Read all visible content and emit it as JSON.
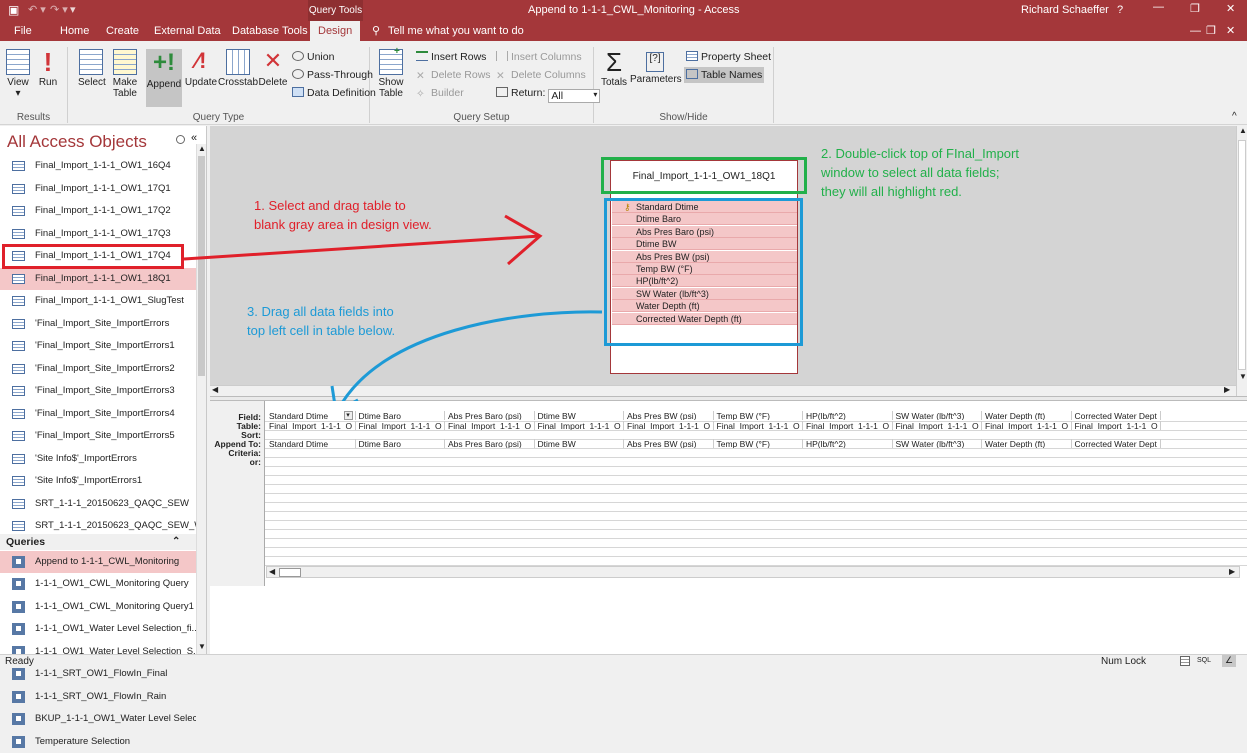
{
  "window": {
    "title": "Append to 1-1-1_CWL_Monitoring - Access",
    "context_tab": "Query Tools",
    "user": "Richard Schaeffer",
    "help": "?",
    "accent": "#a4373a"
  },
  "tabs": [
    "File",
    "Home",
    "Create",
    "External Data",
    "Database Tools",
    "Design",
    "Tell me what you want to do"
  ],
  "ribbon": {
    "results": {
      "label": "Results",
      "view": "View",
      "run": "Run"
    },
    "query_type": {
      "label": "Query Type",
      "select": "Select",
      "make_table": "Make Table",
      "append": "Append",
      "update": "Update",
      "crosstab": "Crosstab",
      "delete": "Delete",
      "union": "Union",
      "pass_through": "Pass-Through",
      "data_definition": "Data Definition"
    },
    "query_setup": {
      "label": "Query Setup",
      "show_table": "Show Table",
      "insert_rows": "Insert Rows",
      "delete_rows": "Delete Rows",
      "builder": "Builder",
      "insert_columns": "Insert Columns",
      "delete_columns": "Delete Columns",
      "return_label": "Return:",
      "return_value": "All"
    },
    "show_hide": {
      "label": "Show/Hide",
      "totals": "Totals",
      "parameters": "Parameters",
      "property_sheet": "Property Sheet",
      "table_names": "Table Names"
    }
  },
  "nav": {
    "title": "All Access Objects",
    "tables": [
      "Final_Import_1-1-1_OW1_16Q4",
      "Final_Import_1-1-1_OW1_17Q1",
      "Final_Import_1-1-1_OW1_17Q2",
      "Final_Import_1-1-1_OW1_17Q3",
      "Final_Import_1-1-1_OW1_17Q4",
      "Final_Import_1-1-1_OW1_18Q1",
      "Final_Import_1-1-1_OW1_SlugTest",
      "'Final_Import_Site_ImportErrors",
      "'Final_Import_Site_ImportErrors1",
      "'Final_Import_Site_ImportErrors2",
      "'Final_Import_Site_ImportErrors3",
      "'Final_Import_Site_ImportErrors4",
      "'Final_Import_Site_ImportErrors5",
      "'Site Info$'_ImportErrors",
      "'Site Info$'_ImportErrors1",
      "SRT_1-1-1_20150623_QAQC_SEW",
      "SRT_1-1-1_20150623_QAQC_SEW_WI..."
    ],
    "queries_header": "Queries",
    "queries": [
      "Append to 1-1-1_CWL_Monitoring",
      "1-1-1_OW1_CWL_Monitoring Query",
      "1-1-1_OW1_CWL_Monitoring Query1",
      "1-1-1_OW1_Water Level Selection_fi...",
      "1-1-1_OW1_Water Level Selection_S...",
      "1-1-1_SRT_OW1_FlowIn_Final",
      "1-1-1_SRT_OW1_FlowIn_Rain",
      "BKUP_1-1-1_OW1_Water Level Selec...",
      "Temperature Selection"
    ]
  },
  "table_window": {
    "title": "Final_Import_1-1-1_OW1_18Q1",
    "fields": [
      "Standard Dtime",
      "Dtime Baro",
      "Abs Pres Baro (psi)",
      "Dtime BW",
      "Abs Pres BW (psi)",
      "Temp BW (°F)",
      "HP(lb/ft^2)",
      "SW Water (lb/ft^3)",
      "Water Depth (ft)",
      "Corrected Water Depth (ft)"
    ]
  },
  "annotations": {
    "step1": [
      "1. Select and drag table to",
      "blank gray area in design view."
    ],
    "step2": [
      "2. Double-click top of FInal_Import",
      "window to select all data fields;",
      "they will all highlight red."
    ],
    "step3": [
      "3. Drag all data fields into",
      "top left cell in table below."
    ],
    "color_red": "#e0202a",
    "color_green": "#22b04a",
    "color_blue": "#1d9ad6"
  },
  "grid": {
    "row_labels": [
      "Field:",
      "Table:",
      "Sort:",
      "Append To:",
      "Criteria:",
      "or:"
    ],
    "columns": [
      {
        "field": "Standard Dtime",
        "table": "Final_Import_1-1-1_O",
        "append": "Standard Dtime"
      },
      {
        "field": "Dtime Baro",
        "table": "Final_Import_1-1-1_O",
        "append": "Dtime Baro"
      },
      {
        "field": "Abs Pres Baro (psi)",
        "table": "Final_Import_1-1-1_O",
        "append": "Abs Pres Baro (psi)"
      },
      {
        "field": "Dtime BW",
        "table": "Final_Import_1-1-1_O",
        "append": "Dtime BW"
      },
      {
        "field": "Abs Pres BW (psi)",
        "table": "Final_Import_1-1-1_O",
        "append": "Abs Pres BW (psi)"
      },
      {
        "field": "Temp BW (°F)",
        "table": "Final_Import_1-1-1_O",
        "append": "Temp BW (°F)"
      },
      {
        "field": "HP(lb/ft^2)",
        "table": "Final_Import_1-1-1_O",
        "append": "HP(lb/ft^2)"
      },
      {
        "field": "SW Water (lb/ft^3)",
        "table": "Final_Import_1-1-1_O",
        "append": "SW Water (lb/ft^3)"
      },
      {
        "field": "Water Depth (ft)",
        "table": "Final_Import_1-1-1_O",
        "append": "Water Depth (ft)"
      },
      {
        "field": "Corrected Water Dept",
        "table": "Final_Import_1-1-1_O",
        "append": "Corrected Water Dept"
      }
    ]
  },
  "status": {
    "left": "Ready",
    "num_lock": "Num Lock",
    "sql": "SQL"
  }
}
